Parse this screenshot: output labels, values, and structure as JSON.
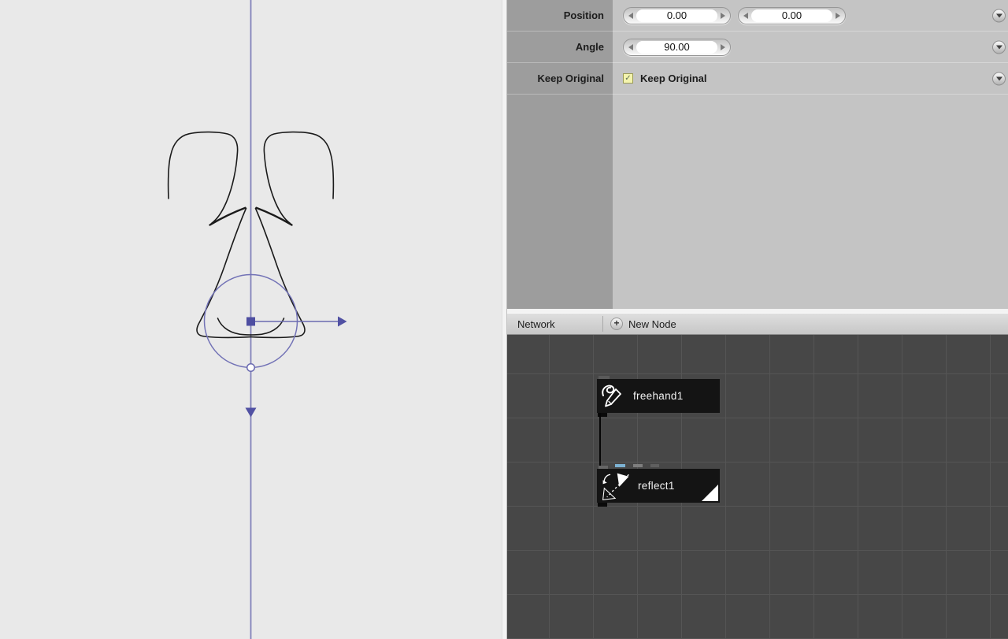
{
  "canvas": {
    "axis_color": "#8181ba",
    "widget_accent": "#5151a3",
    "widget_line": "#6a6ab0",
    "drawing_stroke": "#1b1b1b",
    "background": "#e9e9e9"
  },
  "parameters": {
    "rows": [
      {
        "label": "Position",
        "values": [
          "0.00",
          "0.00"
        ]
      },
      {
        "label": "Angle",
        "values": [
          "90.00"
        ]
      },
      {
        "label": "Keep Original",
        "checkbox_label": "Keep Original",
        "checked": true,
        "check_glyph": "✓"
      }
    ]
  },
  "network": {
    "title": "Network",
    "plus_symbol": "+",
    "new_node_label": "New Node",
    "background": "#474747",
    "node_background": "#141414",
    "nodes": [
      {
        "name": "freehand1",
        "icon": "freehand-pen-icon",
        "rendered": false
      },
      {
        "name": "reflect1",
        "icon": "reflect-cone-icon",
        "rendered": true
      }
    ],
    "ports": [
      {
        "color": "#7cb2d2"
      },
      {
        "color": "#7e7e7e"
      },
      {
        "color": "#5f5f5f"
      }
    ]
  }
}
